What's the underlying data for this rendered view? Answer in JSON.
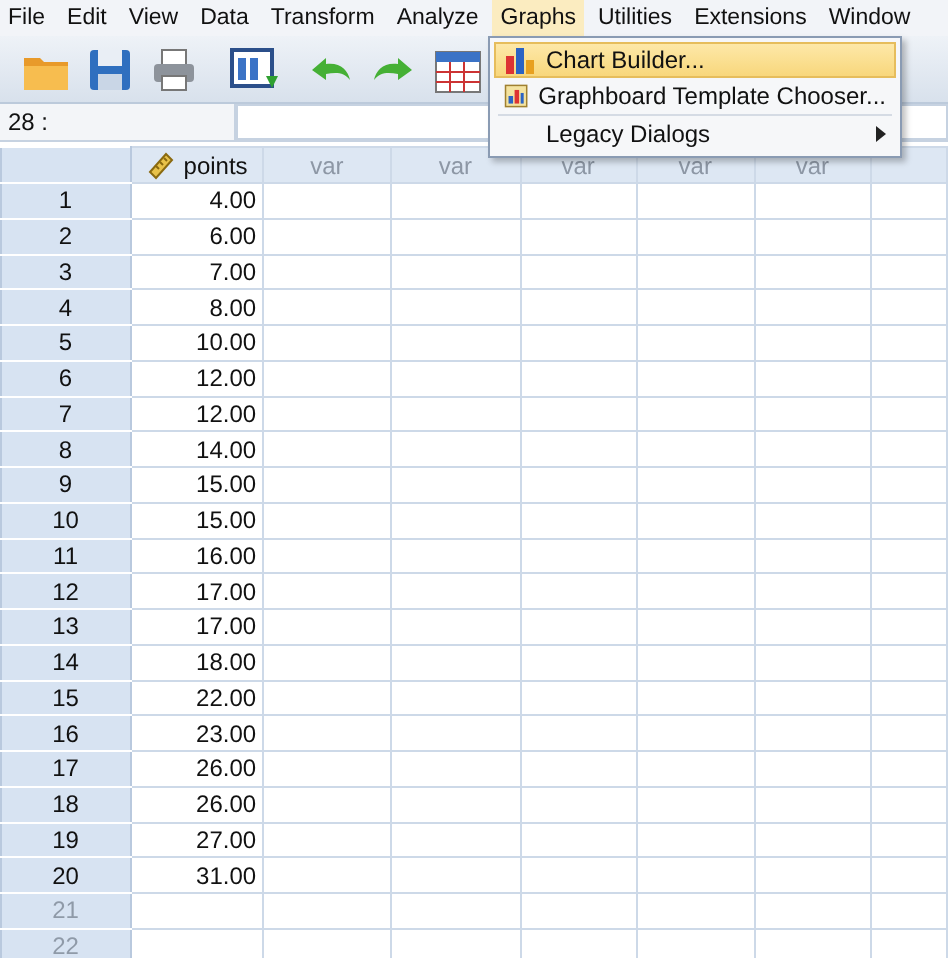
{
  "menu_bar": [
    {
      "label": "File",
      "open": false
    },
    {
      "label": "Edit",
      "open": false
    },
    {
      "label": "View",
      "open": false
    },
    {
      "label": "Data",
      "open": false
    },
    {
      "label": "Transform",
      "open": false
    },
    {
      "label": "Analyze",
      "open": false
    },
    {
      "label": "Graphs",
      "open": true
    },
    {
      "label": "Utilities",
      "open": false
    },
    {
      "label": "Extensions",
      "open": false
    },
    {
      "label": "Window",
      "open": false
    }
  ],
  "graphs_menu": [
    {
      "label": "Chart Builder...",
      "kind": "chart",
      "selected": true
    },
    {
      "label": "Graphboard Template Chooser...",
      "kind": "graphboard",
      "selected": false
    },
    {
      "label": "Legacy Dialogs",
      "kind": "submenu",
      "selected": false
    }
  ],
  "cell_reference": "28 :",
  "columns": [
    {
      "label": "points",
      "kind": "variable"
    },
    {
      "label": "var",
      "kind": "empty"
    },
    {
      "label": "var",
      "kind": "empty"
    },
    {
      "label": "var",
      "kind": "empty"
    },
    {
      "label": "var",
      "kind": "empty"
    },
    {
      "label": "var",
      "kind": "empty"
    }
  ],
  "rows": [
    {
      "number": "1",
      "value": "4.00",
      "empty": false
    },
    {
      "number": "2",
      "value": "6.00",
      "empty": false
    },
    {
      "number": "3",
      "value": "7.00",
      "empty": false
    },
    {
      "number": "4",
      "value": "8.00",
      "empty": false
    },
    {
      "number": "5",
      "value": "10.00",
      "empty": false
    },
    {
      "number": "6",
      "value": "12.00",
      "empty": false
    },
    {
      "number": "7",
      "value": "12.00",
      "empty": false
    },
    {
      "number": "8",
      "value": "14.00",
      "empty": false
    },
    {
      "number": "9",
      "value": "15.00",
      "empty": false
    },
    {
      "number": "10",
      "value": "15.00",
      "empty": false
    },
    {
      "number": "11",
      "value": "16.00",
      "empty": false
    },
    {
      "number": "12",
      "value": "17.00",
      "empty": false
    },
    {
      "number": "13",
      "value": "17.00",
      "empty": false
    },
    {
      "number": "14",
      "value": "18.00",
      "empty": false
    },
    {
      "number": "15",
      "value": "22.00",
      "empty": false
    },
    {
      "number": "16",
      "value": "23.00",
      "empty": false
    },
    {
      "number": "17",
      "value": "26.00",
      "empty": false
    },
    {
      "number": "18",
      "value": "26.00",
      "empty": false
    },
    {
      "number": "19",
      "value": "27.00",
      "empty": false
    },
    {
      "number": "20",
      "value": "31.00",
      "empty": false
    },
    {
      "number": "21",
      "empty": true
    },
    {
      "number": "22",
      "empty": true
    }
  ]
}
